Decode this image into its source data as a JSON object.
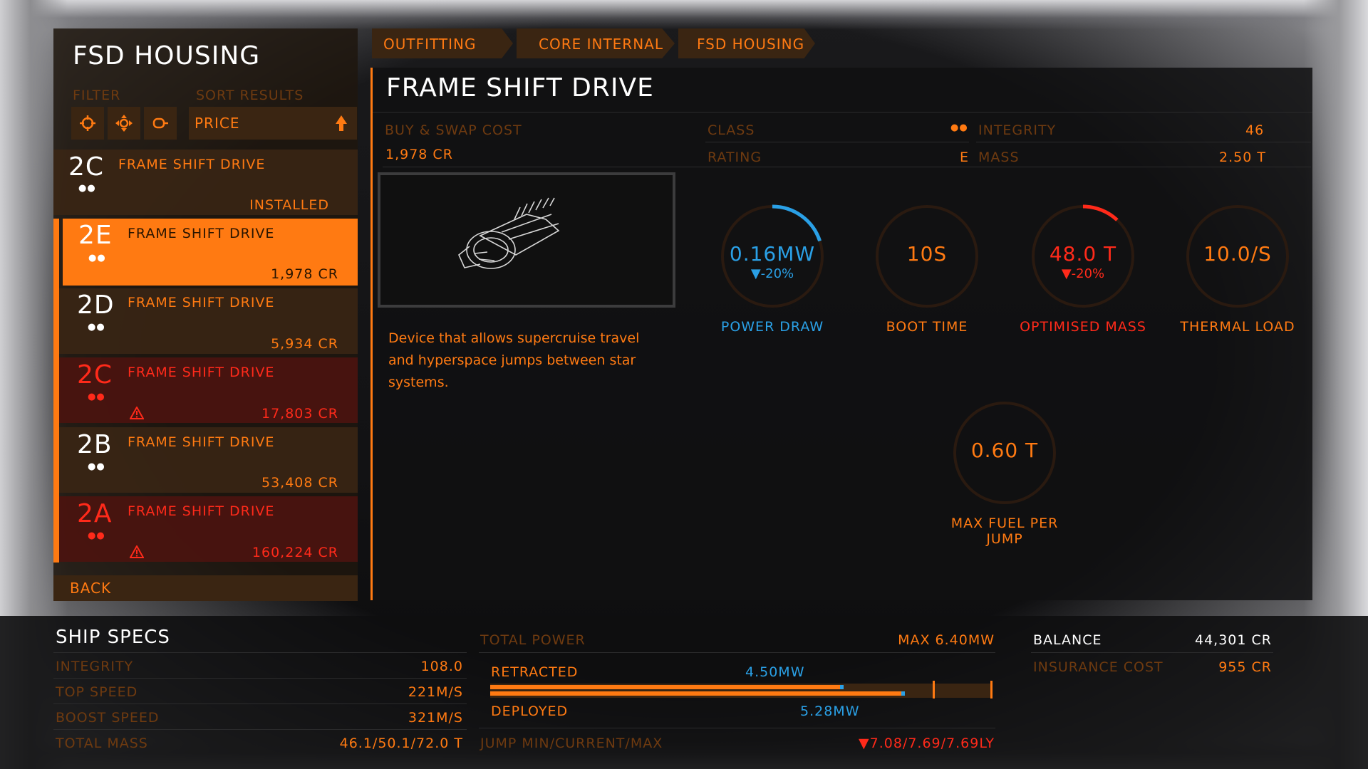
{
  "left": {
    "title": "FSD HOUSING",
    "filter_label": "FILTER",
    "sort_label": "SORT RESULTS",
    "sort_value": "PRICE",
    "back_label": "BACK",
    "items": [
      {
        "code": "2C",
        "dots": "●●",
        "name": "FRAME SHIFT DRIVE",
        "price": "INSTALLED",
        "state": "installed"
      },
      {
        "code": "2E",
        "dots": "●●",
        "name": "FRAME SHIFT DRIVE",
        "price": "1,978 CR",
        "state": "selected"
      },
      {
        "code": "2D",
        "dots": "●●",
        "name": "FRAME SHIFT DRIVE",
        "price": "5,934 CR",
        "state": "normal"
      },
      {
        "code": "2C",
        "dots": "●●",
        "name": "FRAME SHIFT DRIVE",
        "price": "17,803 CR",
        "state": "warning"
      },
      {
        "code": "2B",
        "dots": "●●",
        "name": "FRAME SHIFT DRIVE",
        "price": "53,408 CR",
        "state": "normal"
      },
      {
        "code": "2A",
        "dots": "●●",
        "name": "FRAME SHIFT DRIVE",
        "price": "160,224 CR",
        "state": "warning"
      }
    ]
  },
  "breadcrumb": [
    "OUTFITTING",
    "CORE INTERNAL",
    "FSD HOUSING"
  ],
  "main": {
    "title": "FRAME SHIFT DRIVE",
    "buy_swap_label": "BUY & SWAP COST",
    "buy_swap_value": "1,978 CR",
    "class_label": "CLASS",
    "class_value": "●●",
    "rating_label": "RATING",
    "rating_value": "E",
    "integrity_label": "INTEGRITY",
    "integrity_value": "46",
    "mass_label": "MASS",
    "mass_value": "2.50 T",
    "description": "Device that allows supercruise travel and hyperspace jumps between star systems.",
    "gauges": [
      {
        "value": "0.16MW",
        "sub": "▼-20%",
        "label": "POWER DRAW",
        "color": "#2aa0e6",
        "fill": 0.2
      },
      {
        "value": "10S",
        "sub": "",
        "label": "BOOT TIME",
        "color": "#ff7a12",
        "fill": 0
      },
      {
        "value": "48.0 T",
        "sub": "▼-20%",
        "label": "OPTIMISED MASS",
        "color": "#ff2a1a",
        "fill": 0.12
      },
      {
        "value": "10.0/S",
        "sub": "",
        "label": "THERMAL LOAD",
        "color": "#ff7a12",
        "fill": 0
      },
      {
        "value": "0.60 T",
        "sub": "",
        "label": "MAX FUEL PER JUMP",
        "color": "#ff7a12",
        "fill": 0
      }
    ]
  },
  "specs": {
    "title": "SHIP SPECS",
    "rows": [
      {
        "label": "INTEGRITY",
        "value": "108.0"
      },
      {
        "label": "TOP SPEED",
        "value": "221M/S"
      },
      {
        "label": "BOOST SPEED",
        "value": "321M/S"
      },
      {
        "label": "TOTAL MASS",
        "value": "46.1/50.1/72.0 T"
      }
    ],
    "total_power_label": "TOTAL POWER",
    "total_power_max": "MAX 6.40MW",
    "retracted_label": "RETRACTED",
    "retracted_value": "4.50MW",
    "deployed_label": "DEPLOYED",
    "deployed_value": "5.28MW",
    "jump_label": "JUMP MIN/CURRENT/MAX",
    "jump_value": "▼7.08/7.69/7.69LY",
    "retracted_fraction": 0.703,
    "deployed_fraction": 0.825,
    "balance_label": "BALANCE",
    "balance_value": "44,301 CR",
    "insurance_label": "INSURANCE COST",
    "insurance_value": "955 CR"
  }
}
